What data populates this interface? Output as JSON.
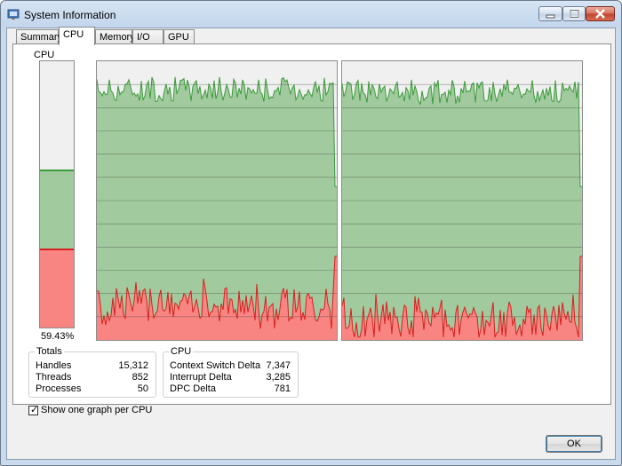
{
  "window": {
    "title": "System Information"
  },
  "tabs": [
    {
      "label": "Summary",
      "active": false
    },
    {
      "label": "CPU",
      "active": true
    },
    {
      "label": "Memory",
      "active": false
    },
    {
      "label": "I/O",
      "active": false
    },
    {
      "label": "GPU",
      "active": false
    }
  ],
  "cpu_meter": {
    "label": "CPU",
    "value_text": "59.43%",
    "total_fraction": 0.5943,
    "kernel_fraction": 0.29,
    "colors": {
      "total": "#a1cb9e",
      "kernel": "#f98582",
      "total_line": "#3c9a3c",
      "kernel_line": "#d62020"
    }
  },
  "graphs": [
    {
      "name": "cpu0",
      "total_level": 0.9,
      "kernel_level": 0.12
    },
    {
      "name": "cpu1",
      "total_level": 0.89,
      "kernel_level": 0.06
    }
  ],
  "totals": {
    "title": "Totals",
    "rows": [
      {
        "label": "Handles",
        "value": "15,312"
      },
      {
        "label": "Threads",
        "value": "852"
      },
      {
        "label": "Processes",
        "value": "50"
      }
    ]
  },
  "cpu_stats": {
    "title": "CPU",
    "rows": [
      {
        "label": "Context Switch Delta",
        "value": "7,347"
      },
      {
        "label": "Interrupt Delta",
        "value": "3,285"
      },
      {
        "label": "DPC Delta",
        "value": "781"
      }
    ]
  },
  "options": {
    "one_graph_per_cpu_label": "Show one graph per CPU",
    "one_graph_per_cpu_checked": true
  },
  "buttons": {
    "ok_label": "OK"
  }
}
